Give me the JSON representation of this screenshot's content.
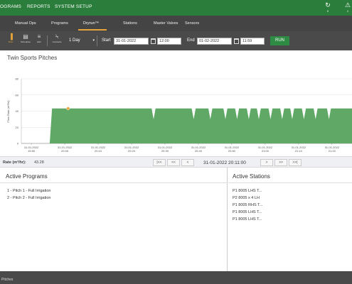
{
  "nav": {
    "items": [
      "OGRAMS",
      "REPORTS",
      "SYSTEM SETUP"
    ],
    "sync_badge": "0",
    "alerts_badge": "1"
  },
  "tabs": [
    "Manual Ops",
    "Programs",
    "Dryrun™",
    "Stations",
    "Master Valves",
    "Sensors"
  ],
  "active_tab": "Dryrun™",
  "toolbar": {
    "buttons": [
      "Flow",
      "Schedules",
      "Edit",
      "Contracts"
    ],
    "period": "1 Day",
    "start_label": "Start",
    "start_date": "31-01-2022",
    "start_time": "12:00",
    "end_label": "End",
    "end_date": "01-02-2022",
    "end_time": "11:59",
    "run_label": "RUN"
  },
  "panel_title": "Twin Sports Pitches",
  "chart_data": {
    "type": "area",
    "ylabel": "Flow Rate (m³/hr)",
    "ylim": [
      0,
      80
    ],
    "yticks": [
      0,
      20,
      40,
      60,
      80
    ],
    "xticks": [
      {
        "date": "31-01-2022",
        "time": "19:50"
      },
      {
        "date": "31-01-2022",
        "time": "20:00"
      },
      {
        "date": "31-01-2022",
        "time": "20:10"
      },
      {
        "date": "31-01-2022",
        "time": "20:20"
      },
      {
        "date": "31-01-2022",
        "time": "20:30"
      },
      {
        "date": "31-01-2022",
        "time": "20:40"
      },
      {
        "date": "31-01-2022",
        "time": "20:50"
      },
      {
        "date": "31-01-2022",
        "time": "21:00"
      },
      {
        "date": "31-01-2022",
        "time": "21:10"
      },
      {
        "date": "31-01-2022",
        "time": "21:20"
      }
    ],
    "xmin_minutes_after_1950": -3,
    "xmax_minutes_after_1950": 96,
    "series": [
      {
        "color": "#5fa866",
        "points_minutes_after_1950": [
          [
            5.5,
            0
          ],
          [
            6.2,
            43.28
          ],
          [
            36,
            43.28
          ],
          [
            36.6,
            30
          ],
          [
            37.2,
            43.28
          ],
          [
            48,
            43.28
          ],
          [
            48.6,
            30
          ],
          [
            49.2,
            43.28
          ],
          [
            53,
            43.28
          ],
          [
            53.6,
            30
          ],
          [
            54.2,
            43.28
          ],
          [
            57.5,
            43.28
          ],
          [
            58.1,
            30
          ],
          [
            58.7,
            43.28
          ],
          [
            61,
            43.28
          ],
          [
            61.6,
            30
          ],
          [
            62.2,
            43.28
          ],
          [
            64.5,
            43.28
          ],
          [
            65.1,
            30
          ],
          [
            65.7,
            43.28
          ],
          [
            67.5,
            43.28
          ],
          [
            68.1,
            30
          ],
          [
            68.7,
            43.28
          ],
          [
            71,
            43.28
          ],
          [
            71.6,
            30
          ],
          [
            72.2,
            43.28
          ],
          [
            74.5,
            43.28
          ],
          [
            75.1,
            30
          ],
          [
            75.7,
            43.28
          ],
          [
            77.5,
            43.28
          ],
          [
            78.1,
            30
          ],
          [
            78.7,
            43.28
          ],
          [
            81,
            43.28
          ],
          [
            81.6,
            30
          ],
          [
            82.2,
            43.28
          ],
          [
            84.5,
            43.28
          ],
          [
            85.1,
            30
          ],
          [
            85.7,
            43.28
          ],
          [
            88.5,
            43.28
          ],
          [
            89.1,
            30
          ],
          [
            89.7,
            43.28
          ],
          [
            96,
            43.28
          ]
        ]
      }
    ],
    "marker": {
      "minutes_after_1950": 11,
      "value": 43.28,
      "color": "#e7a43a"
    },
    "grid": true
  },
  "rate": {
    "label": "Rate (m³/hr):",
    "value": "43.28"
  },
  "pager": [
    "|<<",
    "<<",
    "<",
    ">",
    ">>",
    ">>|"
  ],
  "current_time": "31-01-2022 20:11:00",
  "active_programs": {
    "title": "Active Programs",
    "items": [
      "1 - Pitch 1 - Full Irrigation",
      "2 - Pitch 2 - Full Irrigation"
    ]
  },
  "active_stations": {
    "title": "Active Stations",
    "items": [
      "P1 8005 LHS T...",
      "P2 8005 x 4 LH",
      "P1 8005 RHS T...",
      "P1 8005 LHS T...",
      "P1 8005 LHS T..."
    ]
  },
  "footer": "Pitches",
  "colors": {
    "nav_green": "#2a7d3b",
    "accent": "#e7a43a",
    "run_green": "#2e8b44",
    "area": "#5fa866"
  }
}
